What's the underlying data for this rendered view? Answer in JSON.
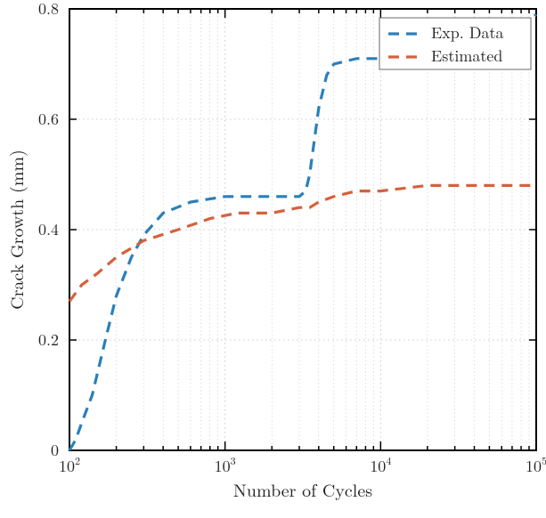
{
  "chart_data": {
    "type": "line",
    "xlabel": "Number of Cycles",
    "ylabel": "Crack Growth (mm)",
    "xscale": "log",
    "xlim": [
      100,
      100000
    ],
    "ylim": [
      0,
      0.8
    ],
    "x_ticks_major": [
      100,
      1000,
      10000,
      100000
    ],
    "x_tick_labels": [
      "10^2",
      "10^3",
      "10^4",
      "10^5"
    ],
    "y_ticks_major": [
      0,
      0.2,
      0.4,
      0.6,
      0.8
    ],
    "y_tick_labels": [
      "0",
      "0.2",
      "0.4",
      "0.6",
      "0.8"
    ],
    "grid": true,
    "legend_position": "top-right",
    "series": [
      {
        "name": "Exp. Data",
        "color": "#2a7fba",
        "x": [
          100,
          110,
          120,
          140,
          170,
          200,
          250,
          300,
          400,
          600,
          1000,
          1500,
          2000,
          3000,
          3300,
          3500,
          3700,
          4000,
          4500,
          5000,
          7000,
          10000,
          20000,
          40000,
          70000,
          100000
        ],
        "y": [
          0.0,
          0.02,
          0.05,
          0.1,
          0.2,
          0.28,
          0.35,
          0.39,
          0.43,
          0.45,
          0.46,
          0.46,
          0.46,
          0.46,
          0.47,
          0.5,
          0.55,
          0.62,
          0.68,
          0.7,
          0.71,
          0.71,
          0.72,
          0.73,
          0.75,
          0.79
        ]
      },
      {
        "name": "Estimated",
        "color": "#d6603d",
        "x": [
          100,
          120,
          150,
          200,
          300,
          500,
          800,
          1200,
          2000,
          3000,
          3500,
          4000,
          5000,
          7000,
          10000,
          20000,
          40000,
          70000,
          100000
        ],
        "y": [
          0.27,
          0.3,
          0.32,
          0.35,
          0.38,
          0.4,
          0.42,
          0.43,
          0.43,
          0.44,
          0.44,
          0.45,
          0.46,
          0.47,
          0.47,
          0.48,
          0.48,
          0.48,
          0.48
        ]
      }
    ]
  },
  "legend": {
    "items": [
      "Exp. Data",
      "Estimated"
    ]
  },
  "axes": {
    "x": {
      "label_base": "10",
      "label_exponents": [
        "2",
        "3",
        "4",
        "5"
      ]
    },
    "y": {
      "labels": [
        "0",
        "0.2",
        "0.4",
        "0.6",
        "0.8"
      ]
    },
    "xlabel": "Number of Cycles",
    "ylabel": "Crack Growth (mm)"
  }
}
